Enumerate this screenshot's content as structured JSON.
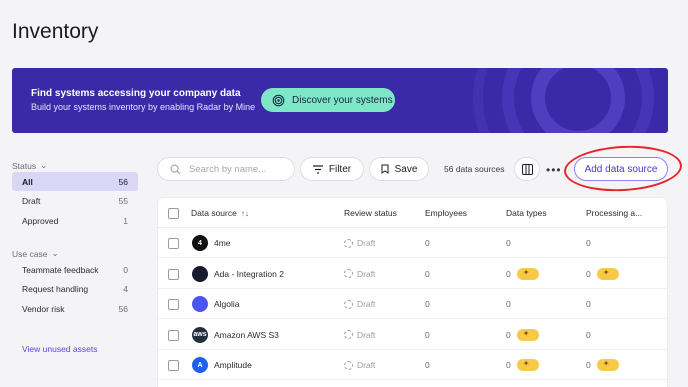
{
  "page": {
    "title": "Inventory"
  },
  "banner": {
    "heading": "Find systems accessing your company data",
    "subtext": "Build your systems inventory by enabling Radar by Mine",
    "button_label": "Discover your systems"
  },
  "sidebar": {
    "status_heading": "Status",
    "status_items": [
      {
        "label": "All",
        "count": "56",
        "active": true
      },
      {
        "label": "Draft",
        "count": "55"
      },
      {
        "label": "Approved",
        "count": "1"
      }
    ],
    "usecase_heading": "Use case",
    "usecase_items": [
      {
        "label": "Teammate feedback",
        "count": "0"
      },
      {
        "label": "Request handling",
        "count": "4"
      },
      {
        "label": "Vendor risk",
        "count": "56"
      }
    ],
    "view_unused": "View unused assets"
  },
  "toolbar": {
    "search_placeholder": "Search by name...",
    "filter_label": "Filter",
    "save_label": "Save",
    "count_text": "56 data sources",
    "more_label": "•••",
    "add_label": "Add data source"
  },
  "table": {
    "columns": [
      "Data source",
      "Review status",
      "Employees",
      "Data types",
      "Processing a..."
    ],
    "sort_indicator": "↑↓",
    "rows": [
      {
        "name": "4me",
        "status": "Draft",
        "employees": "0",
        "data_types": "0",
        "processing": "0",
        "dt_pill": false,
        "pr_pill": false,
        "logo_color": "#111",
        "logo_text": "4"
      },
      {
        "name": "Ada - Integration 2",
        "status": "Draft",
        "employees": "0",
        "data_types": "0",
        "processing": "0",
        "dt_pill": true,
        "pr_pill": true,
        "logo_color": "#1a1a2e",
        "logo_text": ""
      },
      {
        "name": "Algolia",
        "status": "Draft",
        "employees": "0",
        "data_types": "0",
        "processing": "0",
        "dt_pill": false,
        "pr_pill": false,
        "logo_color": "#4a55ef",
        "logo_text": ""
      },
      {
        "name": "Amazon AWS S3",
        "status": "Draft",
        "employees": "0",
        "data_types": "0",
        "processing": "0",
        "dt_pill": true,
        "pr_pill": false,
        "logo_color": "#232f3e",
        "logo_text": "aws"
      },
      {
        "name": "Amplitude",
        "status": "Draft",
        "employees": "0",
        "data_types": "0",
        "processing": "0",
        "dt_pill": true,
        "pr_pill": true,
        "logo_color": "#1e61f0",
        "logo_text": "A"
      }
    ]
  },
  "colors": {
    "banner": "#3b2aa8",
    "accent": "#4a37d0",
    "discover": "#7ee7c8",
    "highlight": "#e6252a",
    "pill": "#f7c948"
  }
}
